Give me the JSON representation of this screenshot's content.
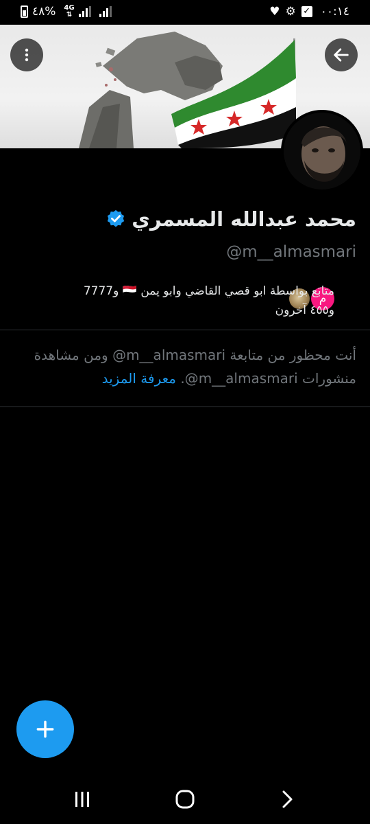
{
  "status_bar": {
    "time": "٠٠:١٤",
    "battery_percent": "٤٨%",
    "network": "4G"
  },
  "profile": {
    "name": "محمد عبدالله المسمري",
    "handle": "@m__almasmari",
    "verified": true,
    "followers_line1": "متابَع بواسطة ابو قصي القاضي وابو يمن 🇾🇪 و7777",
    "followers_line2": "و٤٥٥ آخرون",
    "follower_avatar_letter": "م"
  },
  "blocked_notice": {
    "text_line1": "أنت محظور من متابعة m__almasmari@ ومن مشاهدة",
    "text_line2": "منشورات m__almasmari@.",
    "learn_more": "معرفة المزيد"
  },
  "colors": {
    "accent": "#1d9bf0",
    "background": "#000000",
    "muted_text": "#71767b",
    "divider": "#2f3336",
    "follower_avatar": "#f91880"
  },
  "icons": {
    "back": "arrow-left-icon",
    "more": "more-vertical-icon",
    "verified": "verified-badge-icon",
    "compose": "plus-icon",
    "nav_recents": "recents-icon",
    "nav_home": "home-icon",
    "nav_back": "chevron-right-icon"
  }
}
